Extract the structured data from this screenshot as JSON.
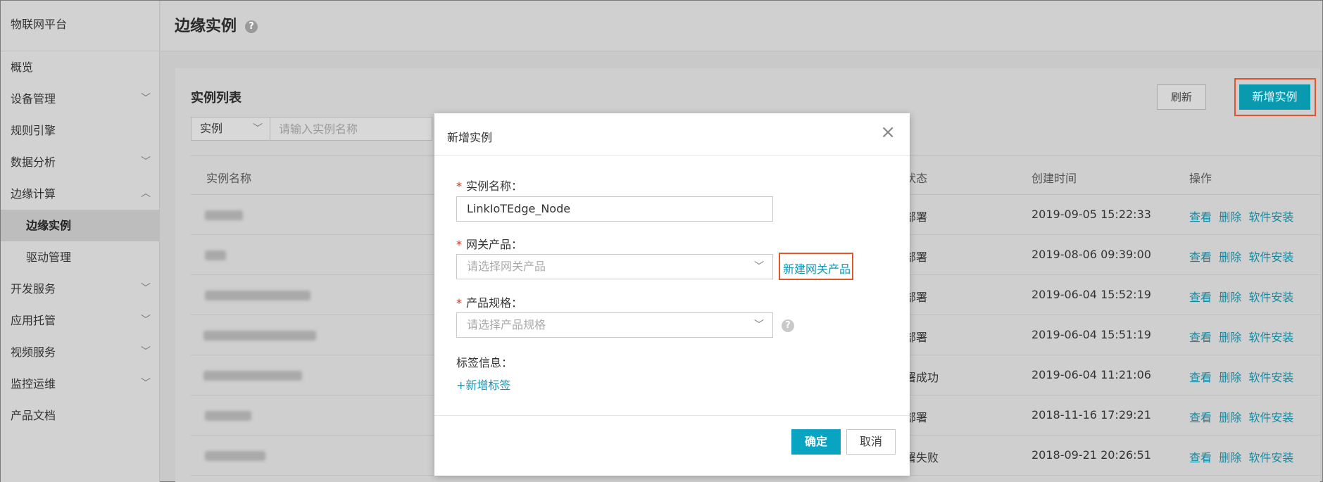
{
  "sidebar": {
    "brand": "物联网平台",
    "items": [
      {
        "label": "概览",
        "chev": ""
      },
      {
        "label": "设备管理",
        "chev": "﹀"
      },
      {
        "label": "规则引擎",
        "chev": ""
      },
      {
        "label": "数据分析",
        "chev": "﹀"
      },
      {
        "label": "边缘计算",
        "chev": "︿"
      },
      {
        "label": "边缘实例",
        "chev": ""
      },
      {
        "label": "驱动管理",
        "chev": ""
      },
      {
        "label": "开发服务",
        "chev": "﹀"
      },
      {
        "label": "应用托管",
        "chev": "﹀"
      },
      {
        "label": "视频服务",
        "chev": "﹀"
      },
      {
        "label": "监控运维",
        "chev": "﹀"
      },
      {
        "label": "产品文档",
        "chev": ""
      }
    ]
  },
  "header": {
    "title": "边缘实例",
    "help": "?"
  },
  "list": {
    "title": "实例列表",
    "filter_select": "实例",
    "filter_placeholder": "请输入实例名称",
    "refresh_label": "刷新",
    "new_label": "新增实例",
    "columns": {
      "name": "实例名称",
      "status": "状态",
      "created": "创建时间",
      "actions": "操作"
    },
    "rows": [
      {
        "status": "部署",
        "created": "2019-09-05 15:22:33"
      },
      {
        "status": "部署",
        "created": "2019-08-06 09:39:00"
      },
      {
        "status": "部署",
        "created": "2019-06-04 15:52:19"
      },
      {
        "status": "部署",
        "created": "2019-06-04 15:51:19"
      },
      {
        "status": "署成功",
        "created": "2019-06-04 11:21:06"
      },
      {
        "status": "部署",
        "created": "2018-11-16 17:29:21"
      },
      {
        "status": "署失败",
        "created": "2018-09-21 20:26:51"
      }
    ],
    "ops": {
      "view": "查看",
      "delete": "删除",
      "install": "软件安装"
    }
  },
  "modal": {
    "title": "新增实例",
    "close_icon": "close-icon",
    "fields": {
      "name_label": "实例名称：",
      "name_value": "LinkIoTEdge_Node",
      "gateway_label": "网关产品：",
      "gateway_placeholder": "请选择网关产品",
      "create_gateway_link": "新建网关产品",
      "spec_label": "产品规格：",
      "spec_placeholder": "请选择产品规格",
      "tag_label": "标签信息：",
      "add_tag": "+新增标签"
    },
    "ok_label": "确定",
    "cancel_label": "取消"
  },
  "colors": {
    "accent": "#0aa4c3",
    "link": "#1295b5",
    "highlight": "#e0552b",
    "required": "#e0321c"
  }
}
